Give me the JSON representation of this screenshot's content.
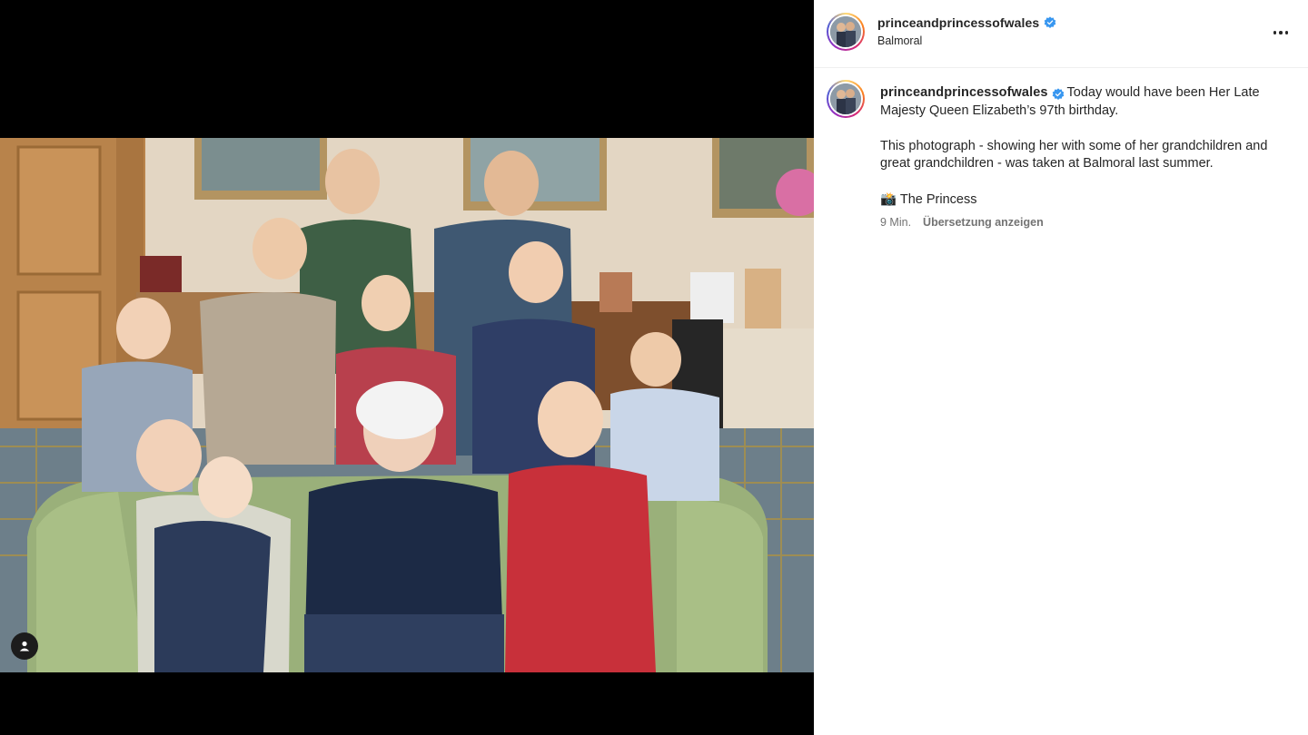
{
  "post": {
    "username": "princeandprincessofwales",
    "verified": true,
    "location": "Balmoral",
    "more_icon": "more-horizontal-icon",
    "caption_line1": "Today would have been Her Late Majesty Queen Elizabeth’s 97th birthday.",
    "caption_line2": "This photograph - showing her with some of her grandchildren and great grandchildren - was taken at Balmoral last summer.",
    "caption_sign_emoji": "📸",
    "caption_sign_text": "The Princess",
    "time_ago": "9 Min.",
    "translate_label": "Übersetzung anzeigen"
  },
  "media": {
    "tag_icon": "user-tag-icon"
  },
  "colors": {
    "verified_blue": "#3897f0",
    "text_primary": "#262626",
    "text_secondary": "#737373",
    "divider": "#efefef"
  }
}
